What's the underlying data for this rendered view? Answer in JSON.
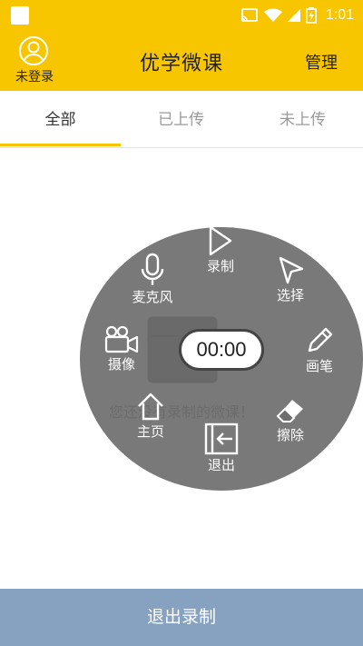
{
  "status_bar": {
    "time": "1:01"
  },
  "header": {
    "login_label": "未登录",
    "title": "优学微课",
    "manage_label": "管理"
  },
  "tabs": [
    {
      "label": "全部"
    },
    {
      "label": "已上传"
    },
    {
      "label": "未上传"
    }
  ],
  "empty_message": "您还没有录制的微课！",
  "record_menu": {
    "timer": "00:00",
    "items": {
      "record": {
        "label": "录制",
        "icon": "play-icon"
      },
      "microphone": {
        "label": "麦克风",
        "icon": "microphone-icon"
      },
      "select": {
        "label": "选择",
        "icon": "cursor-icon"
      },
      "camera": {
        "label": "摄像",
        "icon": "video-camera-icon"
      },
      "pen": {
        "label": "画笔",
        "icon": "pencil-icon"
      },
      "home": {
        "label": "主页",
        "icon": "home-icon"
      },
      "exit": {
        "label": "退出",
        "icon": "exit-icon"
      },
      "erase": {
        "label": "擦除",
        "icon": "eraser-icon"
      }
    }
  },
  "bottom_button": {
    "label": "退出录制"
  },
  "colors": {
    "accent": "#f7c600",
    "bottom_button": "#87a1c1",
    "overlay": "#6e6e6e"
  }
}
